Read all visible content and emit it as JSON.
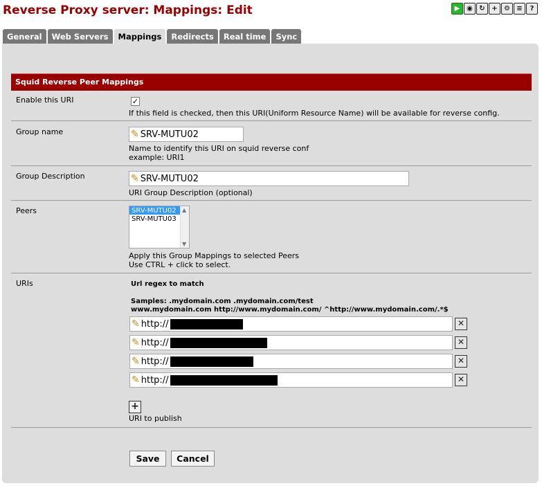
{
  "header": {
    "title": "Reverse Proxy server: Mappings: Edit"
  },
  "toolbar": {
    "icons": [
      "play-icon",
      "log-icon",
      "restart-icon",
      "add-icon",
      "settings-icon",
      "notes-icon",
      "help-icon"
    ]
  },
  "tabs": [
    {
      "label": "General",
      "active": false
    },
    {
      "label": "Web Servers",
      "active": false
    },
    {
      "label": "Mappings",
      "active": true
    },
    {
      "label": "Redirects",
      "active": false
    },
    {
      "label": "Real time",
      "active": false
    },
    {
      "label": "Sync",
      "active": false
    }
  ],
  "section": {
    "title": "Squid Reverse Peer Mappings"
  },
  "form": {
    "enable": {
      "label": "Enable this URI",
      "checked": true,
      "help": "If this field is checked, then this URI(Uniform Resource Name) will be available for reverse config."
    },
    "group_name": {
      "label": "Group name",
      "value": "SRV-MUTU02",
      "help1": "Name to identify this URI on squid reverse conf",
      "help2": "example: URI1"
    },
    "group_description": {
      "label": "Group Description",
      "value": "SRV-MUTU02",
      "help": "URI Group Description (optional)"
    },
    "peers": {
      "label": "Peers",
      "options": [
        "SRV-MUTU02",
        "SRV-MUTU03"
      ],
      "selected": "SRV-MUTU02",
      "help1": "Apply this Group Mappings to selected Peers",
      "help2": "Use CTRL + click to select."
    },
    "uris": {
      "label": "URIs",
      "heading": "Url regex to match",
      "samples1": "Samples: .mydomain.com .mydomain.com/test",
      "samples2": "www.mydomain.com http://www.mydomain.com/ ^http://www.mydomain.com/.*$",
      "rows": [
        {
          "prefix": "http://"
        },
        {
          "prefix": "http://"
        },
        {
          "prefix": "http://"
        },
        {
          "prefix": "http://"
        }
      ],
      "add_label": "URI to publish"
    }
  },
  "buttons": {
    "save": "Save",
    "cancel": "Cancel"
  },
  "colors": {
    "brand": "#990000",
    "tab": "#777777",
    "panel": "#dddddd"
  }
}
